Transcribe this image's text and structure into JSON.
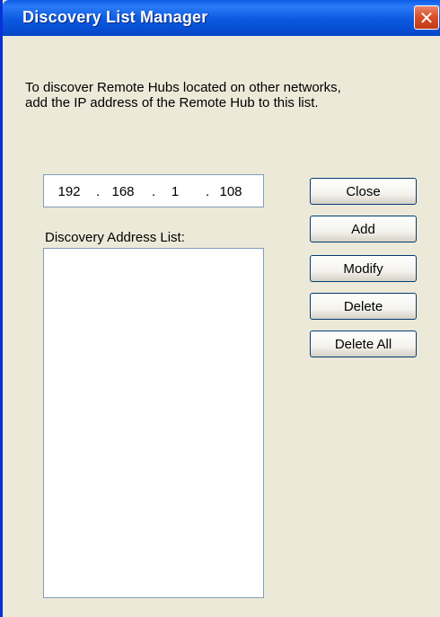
{
  "window": {
    "title": "Discovery List Manager",
    "close_glyph": "✕"
  },
  "description": {
    "line1": "To discover Remote Hubs located on other networks,",
    "line2": "add the IP address of the Remote Hub to this list."
  },
  "ip_address": {
    "octet1": "192",
    "octet2": "168",
    "octet3": "1",
    "octet4": "108",
    "separator": "."
  },
  "list": {
    "label": "Discovery Address List:",
    "items": []
  },
  "buttons": {
    "close": "Close",
    "add": "Add",
    "modify": "Modify",
    "delete": "Delete",
    "delete_all": "Delete All"
  },
  "colors": {
    "titlebar": "#0a59e0",
    "close_button": "#d9502b",
    "dialog_background": "#ece9d8",
    "field_border": "#7f9db9",
    "button_border": "#003c74"
  }
}
